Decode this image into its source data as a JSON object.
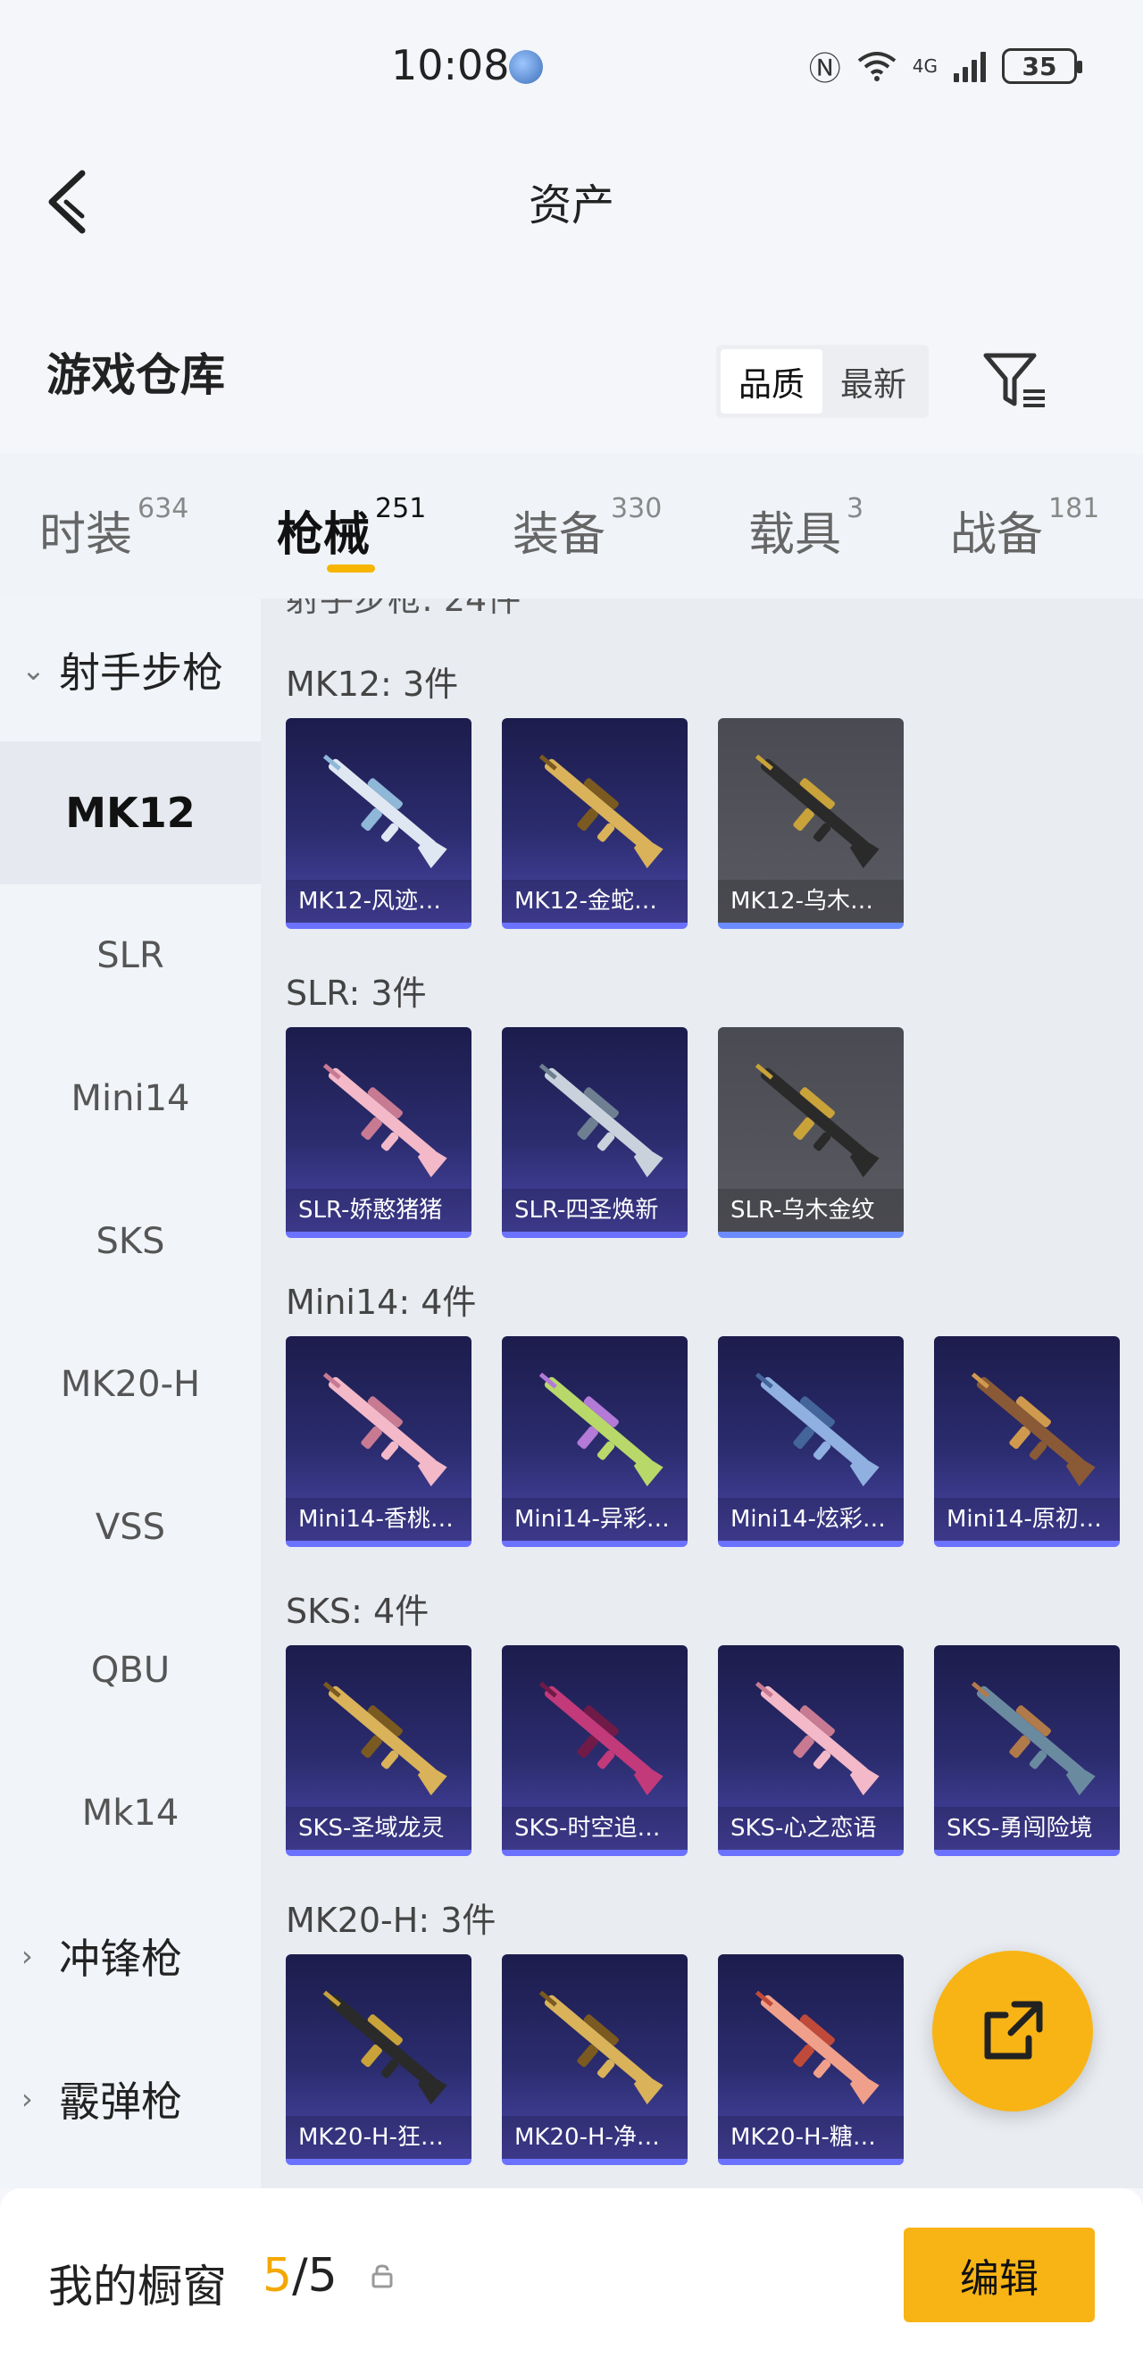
{
  "status_bar": {
    "time": "10:08",
    "network": "4G",
    "network_sub": "6",
    "battery": "35"
  },
  "header": {
    "title": "资产"
  },
  "section": {
    "title": "游戏仓库",
    "sort_options": [
      "品质",
      "最新"
    ],
    "sort_selected": "品质"
  },
  "tabs": [
    {
      "label": "时装",
      "count": "634",
      "active": false
    },
    {
      "label": "枪械",
      "count": "251",
      "active": true
    },
    {
      "label": "装备",
      "count": "330",
      "active": false
    },
    {
      "label": "载具",
      "count": "3",
      "active": false
    },
    {
      "label": "战备",
      "count": "181",
      "active": false
    }
  ],
  "sidebar": {
    "group_open": "射手步枪",
    "items": [
      "MK12",
      "SLR",
      "Mini14",
      "SKS",
      "MK20-H",
      "VSS",
      "QBU",
      "Mk14"
    ],
    "active_item": "MK12",
    "group_collapsed_1": "冲锋枪",
    "group_collapsed_2": "霰弹枪"
  },
  "content": {
    "cut_title": "射手步枪: 24件",
    "groups": [
      {
        "title": "MK12: 3件",
        "items": [
          {
            "name": "MK12-风迹…",
            "tint": "white"
          },
          {
            "name": "MK12-金蛇…",
            "tint": "gold"
          },
          {
            "name": "MK12-乌木…",
            "tint": "black",
            "grey": true
          }
        ]
      },
      {
        "title": "SLR: 3件",
        "items": [
          {
            "name": "SLR-娇憨猪猪",
            "tint": "pink"
          },
          {
            "name": "SLR-四圣焕新",
            "tint": "silver"
          },
          {
            "name": "SLR-乌木金纹",
            "tint": "black",
            "grey": true
          }
        ]
      },
      {
        "title": "Mini14: 4件",
        "items": [
          {
            "name": "Mini14-香桃…",
            "tint": "pink"
          },
          {
            "name": "Mini14-异彩…",
            "tint": "lime"
          },
          {
            "name": "Mini14-炫彩…",
            "tint": "blue"
          },
          {
            "name": "Mini14-原初…",
            "tint": "brown"
          }
        ]
      },
      {
        "title": "SKS: 4件",
        "items": [
          {
            "name": "SKS-圣域龙灵",
            "tint": "gold"
          },
          {
            "name": "SKS-时空追…",
            "tint": "magenta"
          },
          {
            "name": "SKS-心之恋语",
            "tint": "pink"
          },
          {
            "name": "SKS-勇闯险境",
            "tint": "teal"
          }
        ]
      },
      {
        "title": "MK20-H: 3件",
        "items": [
          {
            "name": "MK20-H-狂…",
            "tint": "black"
          },
          {
            "name": "MK20-H-净…",
            "tint": "gold"
          },
          {
            "name": "MK20-H-糖…",
            "tint": "coral"
          }
        ]
      }
    ]
  },
  "bottom_bar": {
    "label": "我的橱窗",
    "current": "5",
    "separator": "/",
    "total": "5",
    "edit_label": "编辑"
  },
  "colors": {
    "accent": "#f8b414",
    "card_bg": "#2b2c6e",
    "card_bar": "#6b72ff"
  },
  "icons": {
    "back": "chevron-left-icon",
    "filter": "filter-list-icon",
    "share": "share-external-icon",
    "lock": "lock-icon"
  }
}
